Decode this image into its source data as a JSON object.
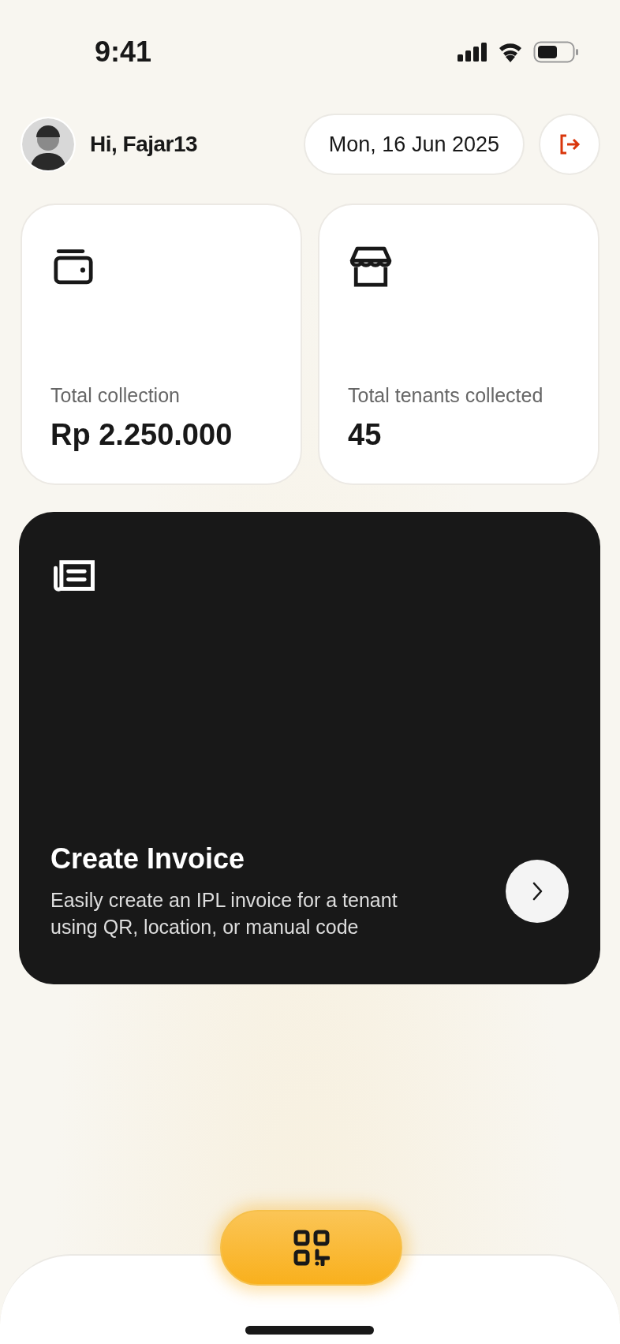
{
  "status_bar": {
    "time": "9:41"
  },
  "header": {
    "greeting": "Hi, Fajar13",
    "date": "Mon, 16 Jun 2025"
  },
  "stats": [
    {
      "kind": "wallet",
      "label": "Total collection",
      "value": "Rp 2.250.000"
    },
    {
      "kind": "store",
      "label": "Total tenants collected",
      "value": "45"
    }
  ],
  "invoice_card": {
    "title": "Create Invoice",
    "description": "Easily create an IPL invoice for a tenant using QR, location, or manual code"
  }
}
